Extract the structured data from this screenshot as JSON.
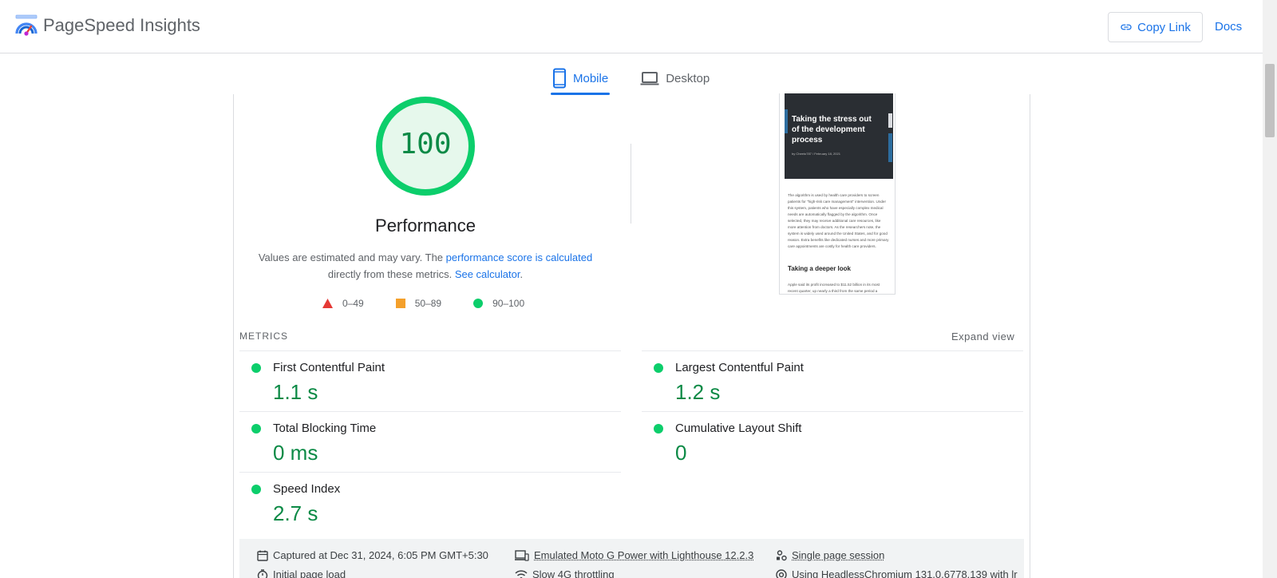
{
  "header": {
    "brand": "PageSpeed Insights",
    "copy_link": "Copy Link",
    "docs": "Docs"
  },
  "tabs": [
    {
      "label": "Mobile",
      "active": true
    },
    {
      "label": "Desktop",
      "active": false
    }
  ],
  "performance": {
    "score": "100",
    "title": "Performance",
    "desc_part1": "Values are estimated and may vary. The ",
    "desc_link1": "performance score is calculated",
    "desc_part2": " directly from these metrics. ",
    "desc_link2": "See calculator",
    "desc_part3": ".",
    "legend": [
      {
        "label": "0–49",
        "color": "#e53935",
        "shape": "triangle"
      },
      {
        "label": "50–89",
        "color": "#f4a02b",
        "shape": "square"
      },
      {
        "label": "90–100",
        "color": "#0cce6b",
        "shape": "circle"
      }
    ]
  },
  "preview": {
    "hero_title": "Taking the stress out of the development process",
    "hero_meta": "by Cheeto787  /  February 18, 2021",
    "body_text": "The algorithm is used by health care providers to screen patients for \"high-risk care management\" intervention. Under this system, patients who have especially complex medical needs are automatically flagged by the algorithm. Once selected, they may receive additional care resources, like more attention from doctors. As the researchers note, the system is widely used around the United States, and for good reason. Extra benefits like dedicated nurses and more primary care appointments are costly for health care providers.",
    "subheading": "Taking a deeper look",
    "body_text2": "Apple said its profit increased to $11.52 billion in its most recent quarter, up nearly a third from the same period a"
  },
  "metrics": {
    "label": "METRICS",
    "expand": "Expand view",
    "items": [
      {
        "name": "First Contentful Paint",
        "value": "1.1 s"
      },
      {
        "name": "Largest Contentful Paint",
        "value": "1.2 s"
      },
      {
        "name": "Total Blocking Time",
        "value": "0 ms"
      },
      {
        "name": "Cumulative Layout Shift",
        "value": "0"
      },
      {
        "name": "Speed Index",
        "value": "2.7 s"
      }
    ]
  },
  "info": {
    "captured": "Captured at Dec 31, 2024, 6:05 PM GMT+5:30",
    "emulated": "Emulated Moto G Power with Lighthouse 12.2.3",
    "session": "Single page session",
    "initial_load": "Initial page load",
    "throttling": "Slow 4G throttling",
    "browser": "Using HeadlessChromium 131.0.6778.139 with lr"
  },
  "colors": {
    "accent": "#1a73e8",
    "pass": "#0cce6b",
    "pass_text": "#0c8a46"
  }
}
